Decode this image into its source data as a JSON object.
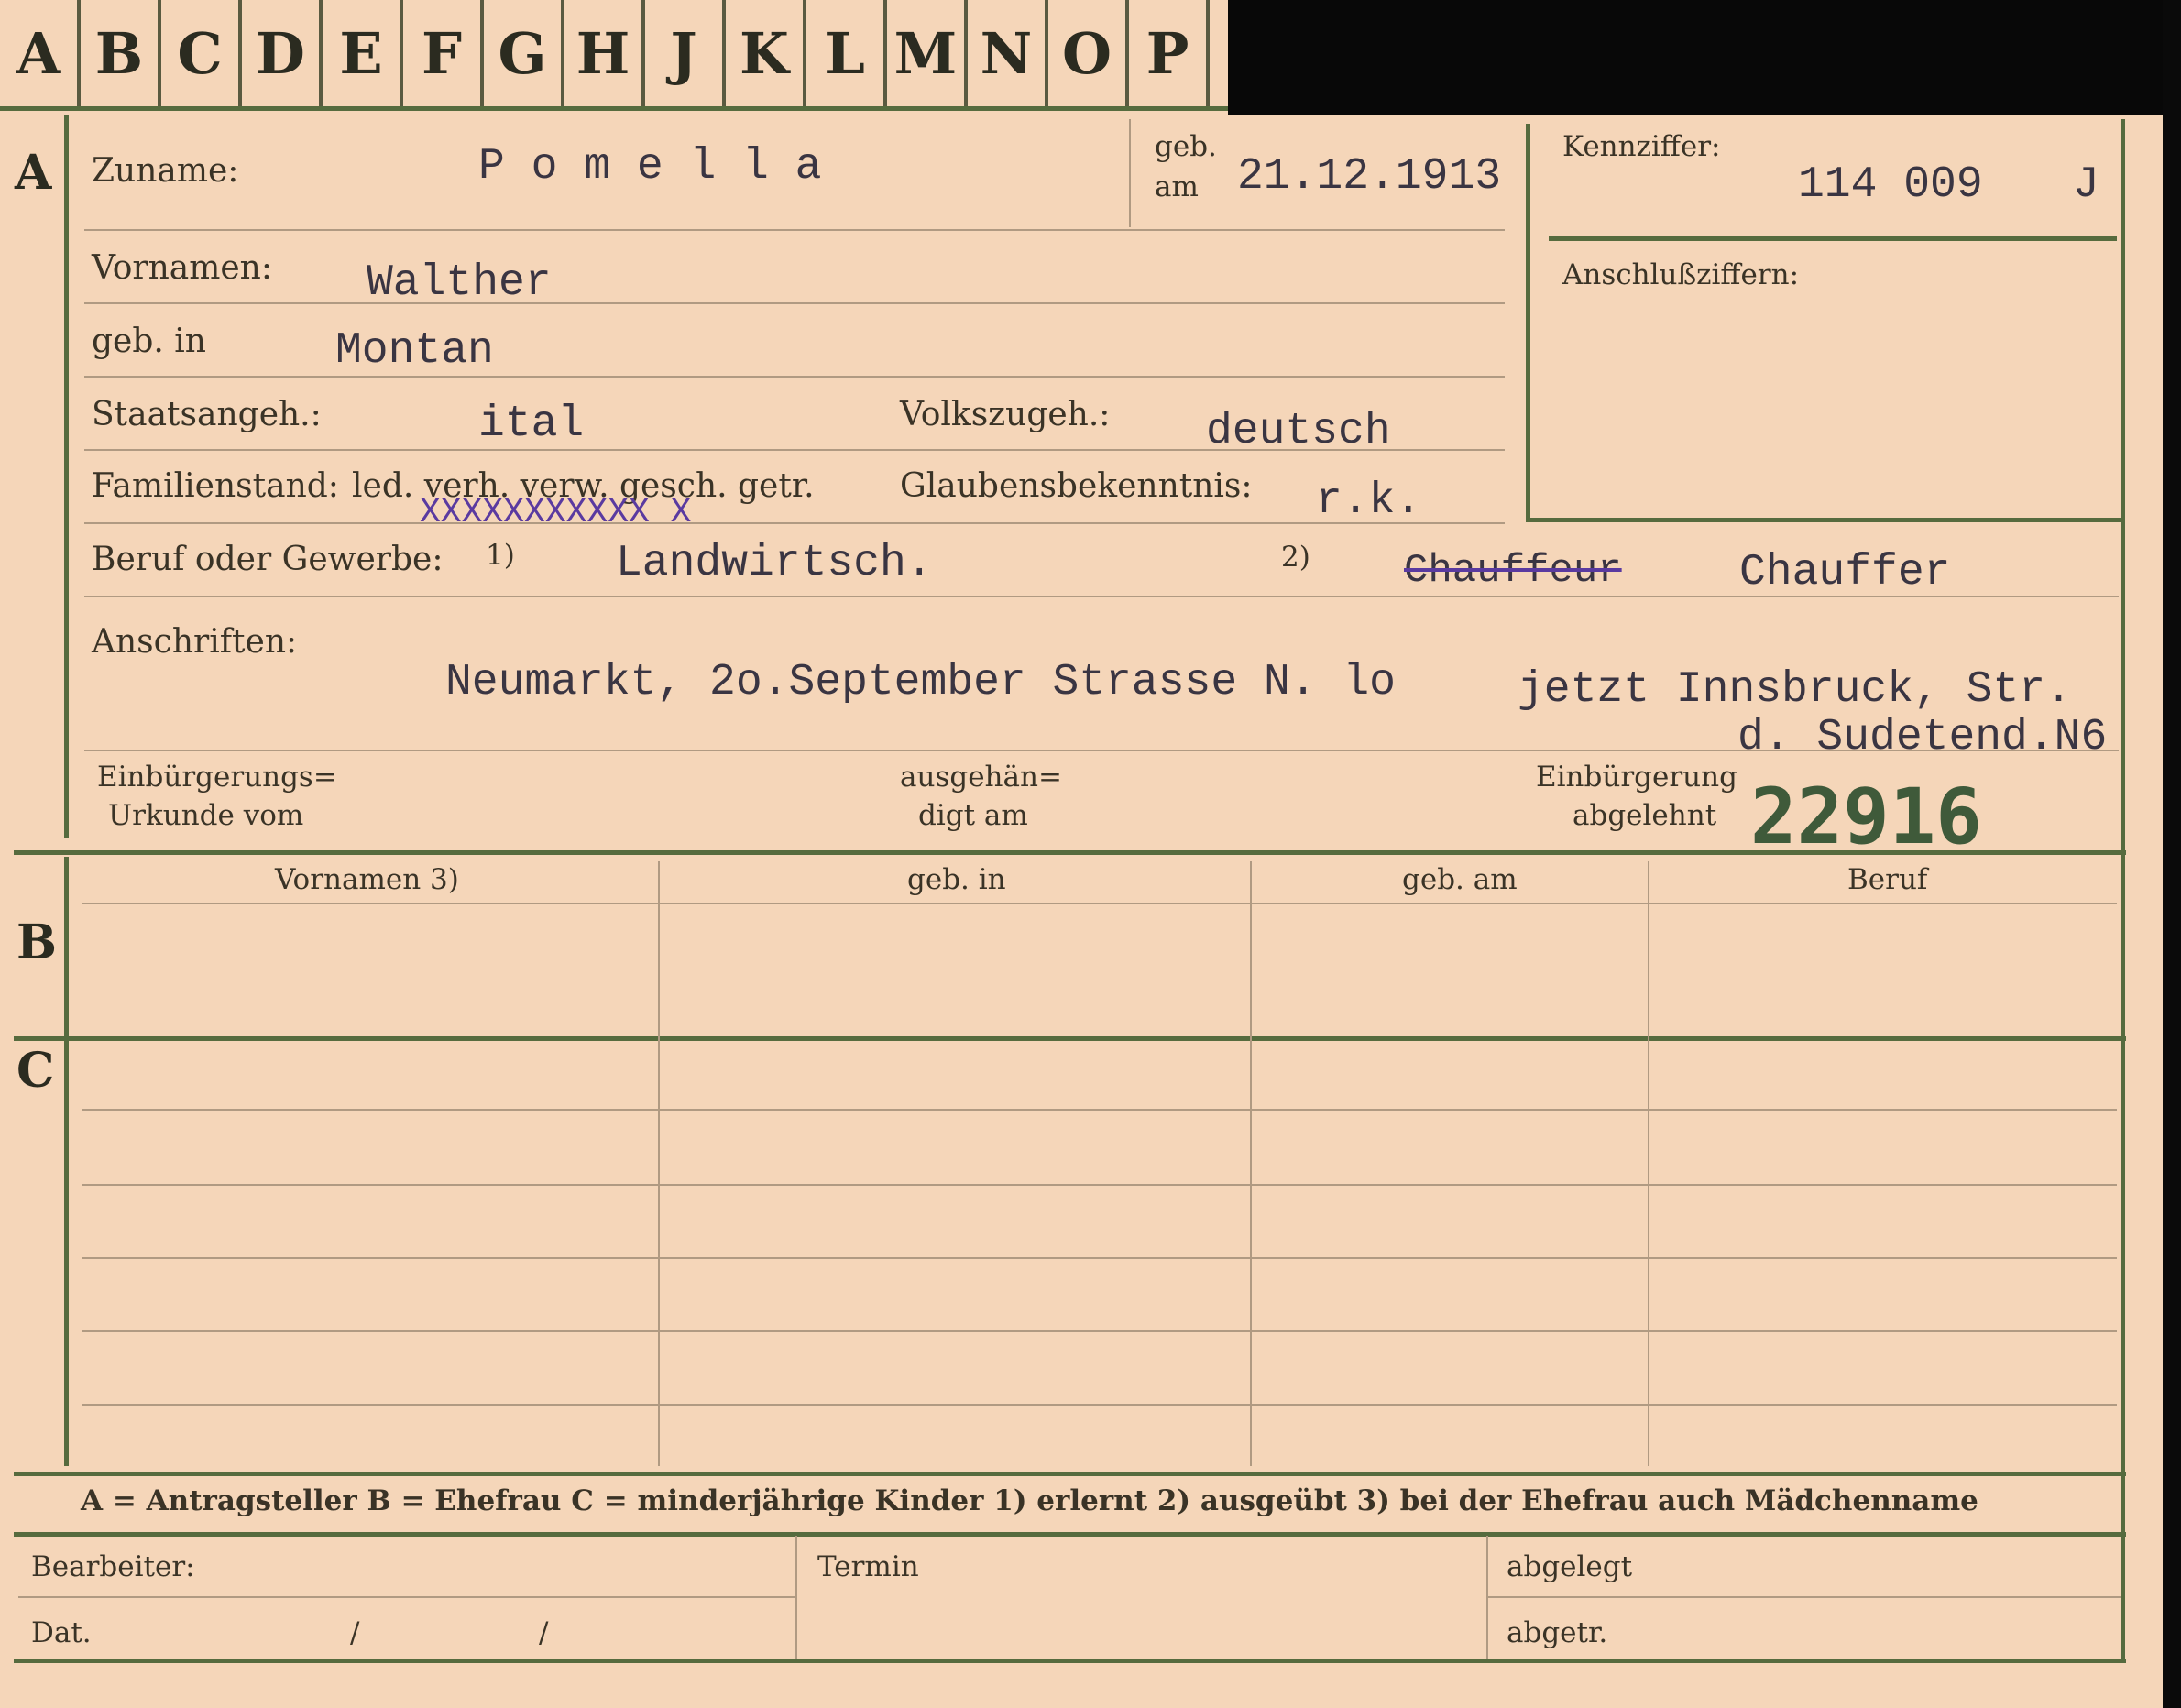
{
  "tabs": [
    "A",
    "B",
    "C",
    "D",
    "E",
    "F",
    "G",
    "H",
    "J",
    "K",
    "L",
    "M",
    "N",
    "O",
    "P"
  ],
  "sections": {
    "a": "A",
    "b": "B",
    "c": "C"
  },
  "labels": {
    "zuname": "Zuname:",
    "geb_am_1": "geb.",
    "geb_am_2": "am",
    "kennziffer": "Kennziffer:",
    "anschluss": "Anschlußziffern:",
    "vornamen": "Vornamen:",
    "geb_in": "geb. in",
    "staatsangeh": "Staatsangeh.:",
    "volkszugeh": "Volkszugeh.:",
    "familienstand": "Familienstand:",
    "familienstand_opts": "led. verh. verw. gesch. getr.",
    "glauben": "Glaubensbekenntnis:",
    "beruf": "Beruf oder Gewerbe:",
    "fn1": "1)",
    "fn2": "2)",
    "anschriften": "Anschriften:",
    "einb_urk_1": "Einbürgerungs=",
    "einb_urk_2": "Urkunde vom",
    "ausgeh_1": "ausgehän=",
    "ausgeh_2": "digt am",
    "einb_abg_1": "Einbürgerung",
    "einb_abg_2": "abgelehnt"
  },
  "values": {
    "zuname": "P o m e l l a",
    "geb_am": "21.12.1913",
    "kennziffer": "114 009",
    "kennziffer_suffix": "J",
    "vornamen": "Walther",
    "geb_in": "Montan",
    "staatsangeh": "ital",
    "volkszugeh": "deutsch",
    "familienstand_mark": "XXXXXXXXXXX X",
    "glauben": "r.k.",
    "beruf1": "Landwirtsch.",
    "beruf2_struck": "Chauffeur",
    "beruf2": "Chauffer",
    "anschrift1": "Neumarkt, 2o.September Strasse N. lo",
    "anschrift2": "jetzt Innsbruck, Str.",
    "anschrift3": "d. Sudetend.N6",
    "stamp_number": "22916"
  },
  "table_headers": [
    "Vornamen 3)",
    "geb. in",
    "geb. am",
    "Beruf"
  ],
  "legend": "A = Antragsteller   B = Ehefrau   C = minderjährige Kinder   1) erlernt   2) ausgeübt   3) bei der Ehefrau auch Mädchenname",
  "footer": {
    "bearbeiter": "Bearbeiter:",
    "dat": "Dat.",
    "slash": "/",
    "termin": "Termin",
    "abgelegt": "abgelegt",
    "abgetr": "abgetr."
  },
  "colors": {
    "paper": "#f5d6b9",
    "rule": "#566b3e",
    "ink": "#3a3542",
    "stamp": "#3f5a3a"
  }
}
